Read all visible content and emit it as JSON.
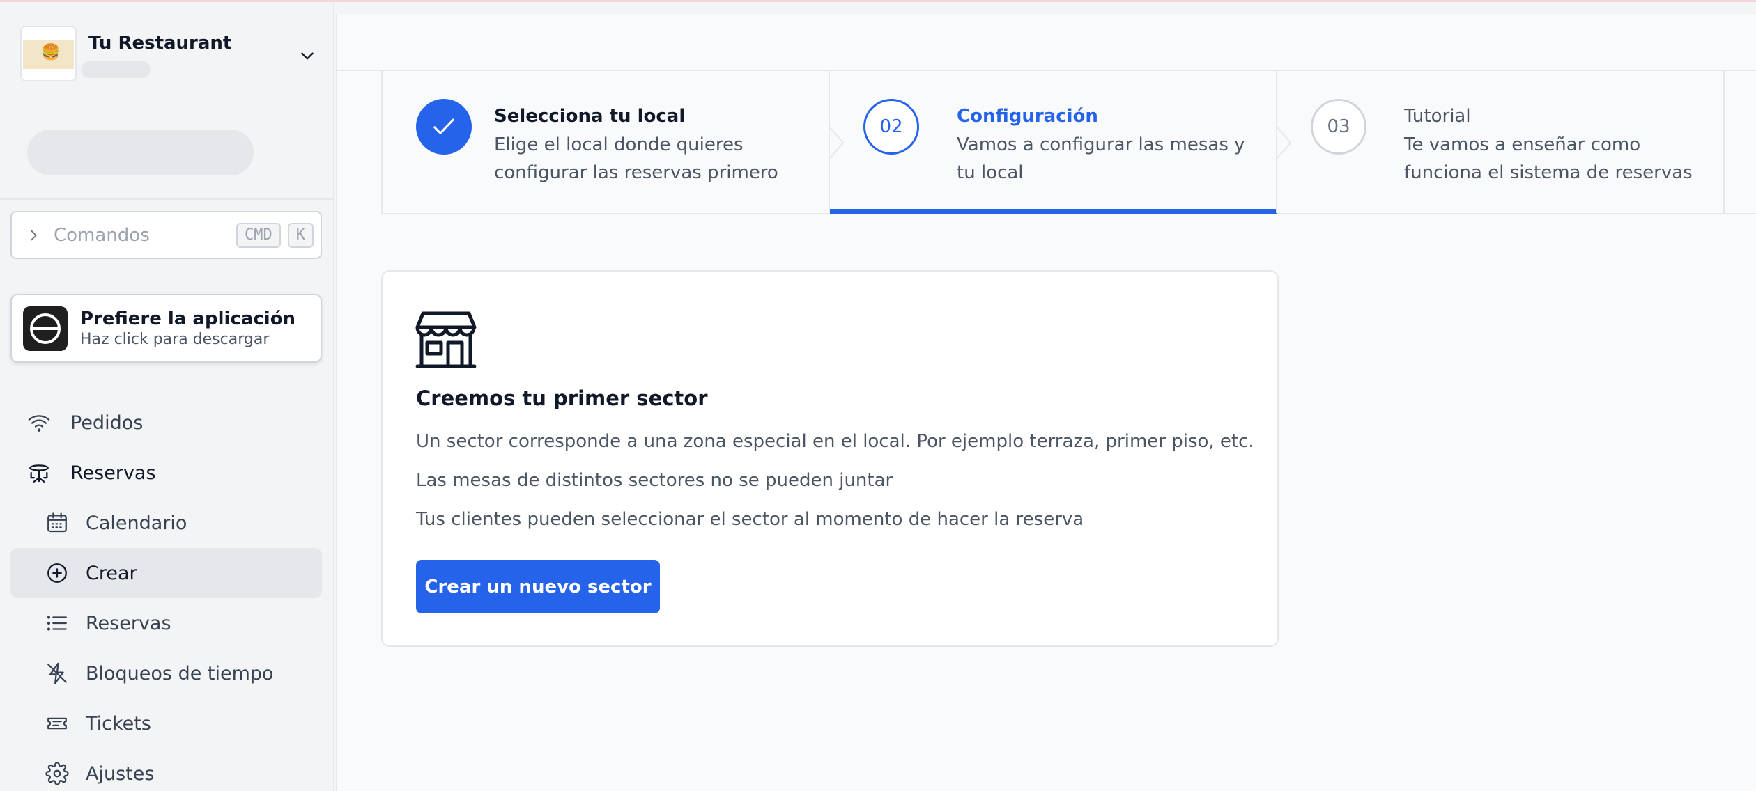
{
  "sidebar": {
    "restaurant_name": "Tu Restaurant",
    "commands": {
      "placeholder": "Comandos",
      "kbd1": "CMD",
      "kbd2": "K"
    },
    "app_banner": {
      "title": "Prefiere la aplicación",
      "subtitle": "Haz click para descargar"
    },
    "nav": [
      {
        "label": "Pedidos",
        "icon": "wifi-icon"
      },
      {
        "label": "Reservas",
        "icon": "table-icon"
      },
      {
        "label": "Calendario",
        "icon": "calendar-icon"
      },
      {
        "label": "Crear",
        "icon": "plus-circle-icon",
        "active": true
      },
      {
        "label": "Reservas",
        "icon": "list-icon"
      },
      {
        "label": "Bloqueos de tiempo",
        "icon": "time-block-icon"
      },
      {
        "label": "Tickets",
        "icon": "ticket-icon"
      },
      {
        "label": "Ajustes",
        "icon": "gear-icon"
      }
    ]
  },
  "steps": [
    {
      "title": "Selecciona tu local",
      "desc": "Elige el local donde quieres configurar las reservas primero",
      "status": "completed"
    },
    {
      "number": "02",
      "title": "Configuración",
      "desc": "Vamos a configurar las mesas y tu local",
      "status": "current"
    },
    {
      "number": "03",
      "title": "Tutorial",
      "desc": "Te vamos a enseñar como funciona el sistema de reservas",
      "status": "upcoming"
    }
  ],
  "card": {
    "icon": "store-icon",
    "title": "Creemos tu primer sector",
    "p1": "Un sector corresponde a una zona especial en el local. Por ejemplo terraza, primer piso, etc.",
    "p2": "Las mesas de distintos sectores no se pueden juntar",
    "p3": "Tus clientes pueden seleccionar el sector al momento de hacer la reserva",
    "button": "Crear un nuevo sector"
  },
  "colors": {
    "accent": "#2563eb"
  }
}
